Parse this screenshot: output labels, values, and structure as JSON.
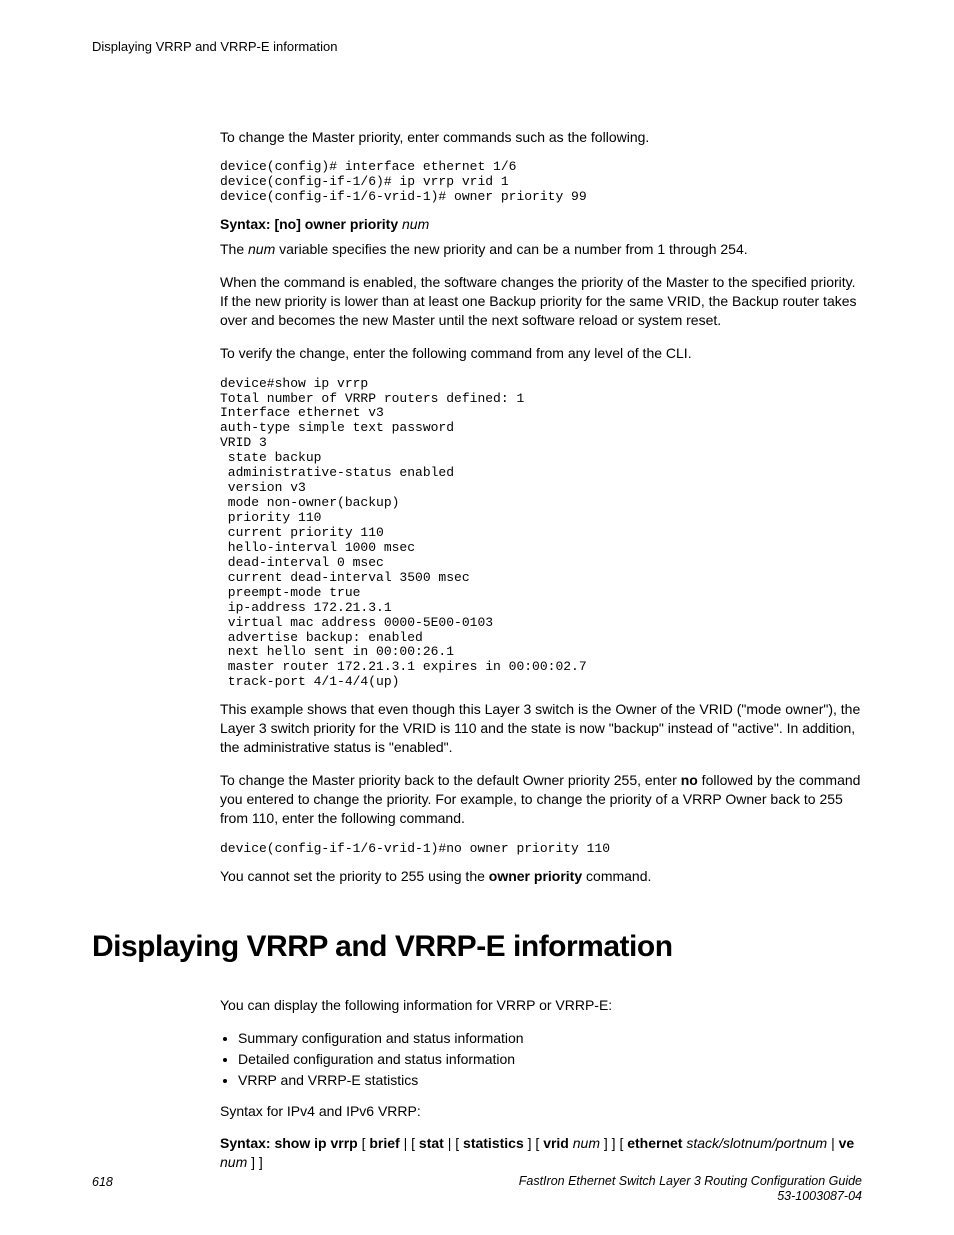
{
  "running_head": "Displaying VRRP and VRRP-E information",
  "p_intro1": "To change the Master priority, enter commands such as the following.",
  "code1": "device(config)# interface ethernet 1/6\ndevice(config-if-1/6)# ip vrrp vrid 1\ndevice(config-if-1/6-vrid-1)# owner priority 99",
  "syntax1_bold": "Syntax: [no] owner priority",
  "syntax1_var": "num",
  "p_num_prefix": "The ",
  "p_num_var": "num",
  "p_num_suffix": " variable specifies the new priority and can be a number from 1 through 254.",
  "p_enabled": "When the command is enabled, the software changes the priority of the Master to the specified priority. If the new priority is lower than at least one Backup priority for the same VRID, the Backup router takes over and becomes the new Master until the next software reload or system reset.",
  "p_verify": "To verify the change, enter the following command from any level of the CLI.",
  "code2": "device#show ip vrrp\nTotal number of VRRP routers defined: 1\nInterface ethernet v3\nauth-type simple text password\nVRID 3\n state backup\n administrative-status enabled\n version v3\n mode non-owner(backup)\n priority 110\n current priority 110\n hello-interval 1000 msec\n dead-interval 0 msec\n current dead-interval 3500 msec\n preempt-mode true\n ip-address 172.21.3.1\n virtual mac address 0000-5E00-0103\n advertise backup: enabled\n next hello sent in 00:00:26.1\n master router 172.21.3.1 expires in 00:00:02.7\n track-port 4/1-4/4(up)",
  "p_example": "This example shows that even though this Layer 3 switch is the Owner of the VRID (\"mode owner\"), the Layer 3 switch priority for the VRID is 110 and the state is now \"backup\" instead of \"active\". In addition, the administrative status is \"enabled\".",
  "p_changeback_pre": "To change the Master priority back to the default Owner priority 255, enter ",
  "p_changeback_bold": "no",
  "p_changeback_post": " followed by the command you entered to change the priority. For example, to change the priority of a VRRP Owner back to 255 from 110, enter the following command.",
  "code3": "device(config-if-1/6-vrid-1)#no owner priority 110",
  "p_cannot_pre": "You cannot set the priority to 255 using the ",
  "p_cannot_bold": "owner priority",
  "p_cannot_post": " command.",
  "h1": "Displaying VRRP and VRRP-E information",
  "p_display": "You can display the following information for VRRP or VRRP-E:",
  "bullets": {
    "b1": "Summary configuration and status information",
    "b2": "Detailed configuration and status information",
    "b3": "VRRP and VRRP-E statistics"
  },
  "p_syntaxfor": "Syntax for IPv4 and IPv6 VRRP:",
  "syntax2": {
    "s1": "Syntax: show ip vrrp",
    "b1": " [ ",
    "s2": "brief",
    "b2": " | [ ",
    "s3": "stat",
    "b3": " | [ ",
    "s4": "statistics",
    "b4": " ] [ ",
    "s5": "vrid",
    "v1": " num",
    "b5": " ] ] [ ",
    "s6": "ethernet",
    "v2": " stack/slotnum/portnum",
    "b6": " | ",
    "s7": "ve",
    "v3": "num",
    "b7": " ] ]"
  },
  "footer": {
    "page": "618",
    "title": "FastIron Ethernet Switch Layer 3 Routing Configuration Guide",
    "docnum": "53-1003087-04"
  }
}
